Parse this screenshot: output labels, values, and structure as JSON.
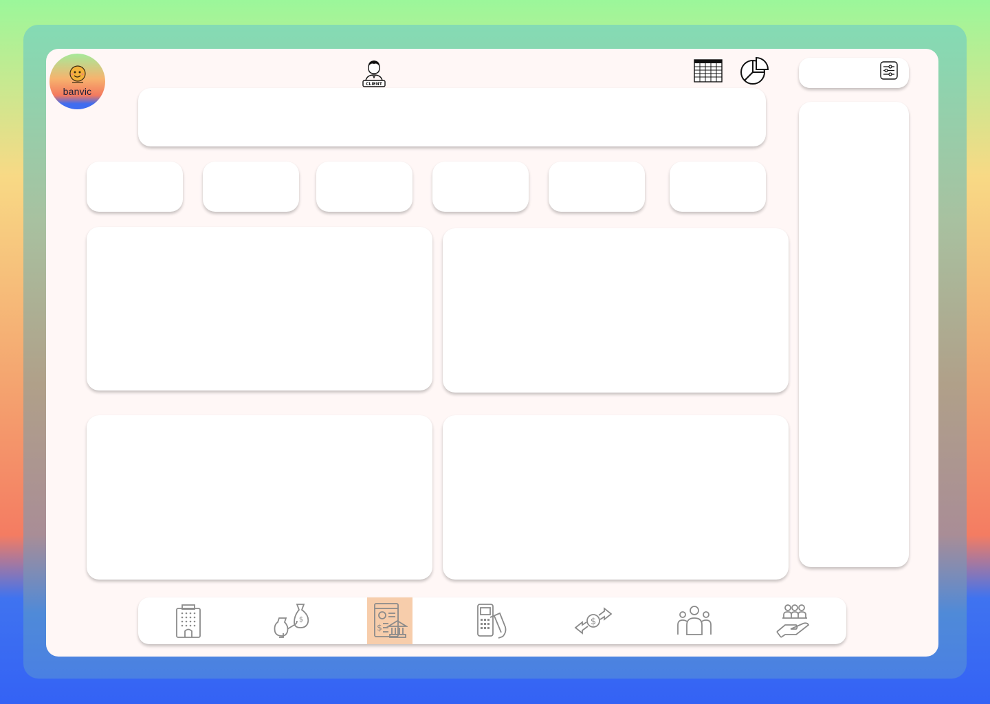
{
  "brand": {
    "name": "banvic"
  },
  "header": {
    "client_icon": "client-icon",
    "client_caption": "CLIENT",
    "table_view_icon": "table-grid-icon",
    "chart_view_icon": "pie-chart-icon",
    "filter_icon": "filter-sliders-icon"
  },
  "bottom_nav": {
    "items": [
      {
        "name": "agencies",
        "icon": "building-icon",
        "active": false
      },
      {
        "name": "investments",
        "icon": "money-bag-icon",
        "active": false
      },
      {
        "name": "accounts",
        "icon": "bank-statement-icon",
        "active": true
      },
      {
        "name": "card-payments",
        "icon": "pos-terminal-icon",
        "active": false
      },
      {
        "name": "transactions",
        "icon": "money-exchange-icon",
        "active": false
      },
      {
        "name": "clients",
        "icon": "group-icon",
        "active": false
      },
      {
        "name": "employees",
        "icon": "team-care-icon",
        "active": false
      }
    ]
  },
  "colors": {
    "active_nav": "#f7cdab",
    "icon_gray": "#8a8a8a",
    "canvas": "#fff7f6"
  }
}
